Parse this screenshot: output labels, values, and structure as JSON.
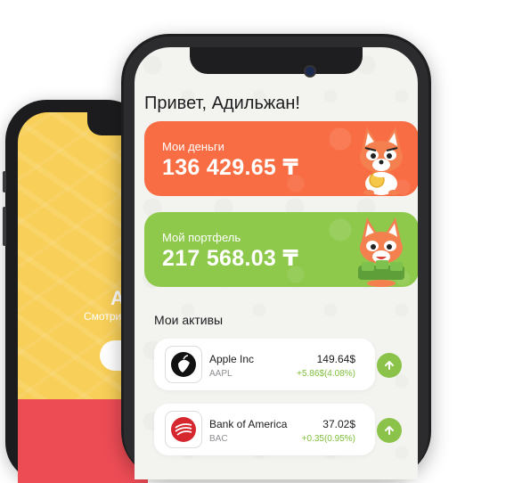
{
  "greeting": "Привет, Адильжан!",
  "cards": {
    "money": {
      "label": "Мои деньги",
      "value": "136 429.65 ₸",
      "color": "#f86d44"
    },
    "portfolio": {
      "label": "Мой портфель",
      "value": "217 568.03 ₸",
      "color": "#8ec94c"
    }
  },
  "assets": {
    "title": "Мои активы",
    "items": [
      {
        "name": "Apple Inc",
        "ticker": "AAPL",
        "price": "149.64$",
        "change": "+5.86$(4.08%)",
        "logo": "apple-logo-icon"
      },
      {
        "name": "Bank of America",
        "ticker": "BAC",
        "price": "37.02$",
        "change": "+0.35(0.95%)",
        "logo": "bank-of-america-logo-icon"
      }
    ]
  },
  "back_screen": {
    "title": "А",
    "subtitle": "Смотри",
    "color": "#f8cf58",
    "bottom_color": "#ee4c55"
  },
  "accent_up": "#8bc34a",
  "positive_color": "#7dbf3a"
}
